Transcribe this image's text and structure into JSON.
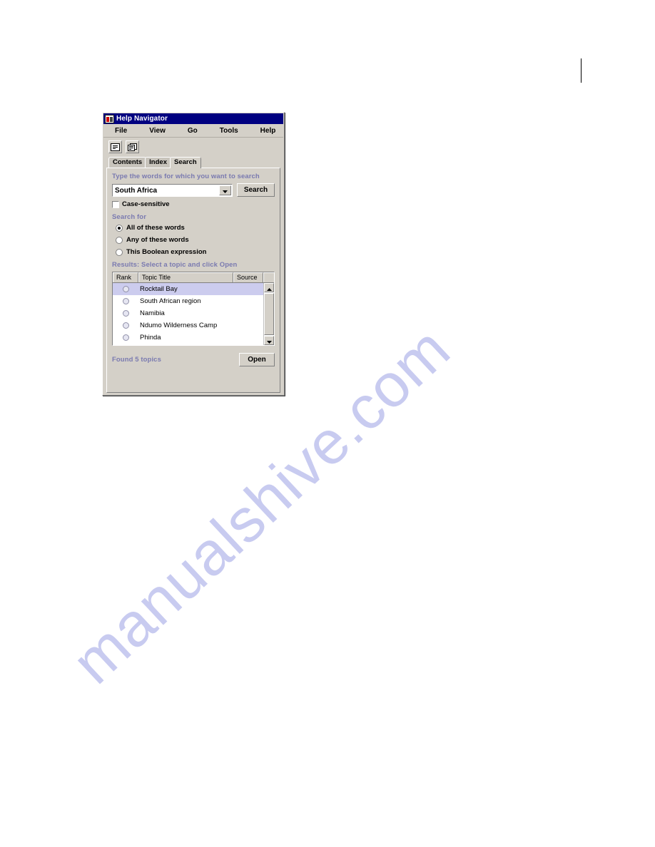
{
  "page": {
    "watermark_text": "manualshive.com"
  },
  "window": {
    "title": "Help Navigator",
    "icon": "help-book-icon"
  },
  "menubar": {
    "items": [
      {
        "label": "File"
      },
      {
        "label": "View"
      },
      {
        "label": "Go"
      },
      {
        "label": "Tools"
      },
      {
        "label": "Help"
      }
    ]
  },
  "toolbar": {
    "buttons": [
      {
        "icon": "single-pane-icon"
      },
      {
        "icon": "dual-pane-icon"
      }
    ]
  },
  "tabs": [
    {
      "label": "Contents",
      "active": false
    },
    {
      "label": "Index",
      "active": false
    },
    {
      "label": "Search",
      "active": true
    }
  ],
  "search_panel": {
    "prompt_label": "Type the words for which you want to search",
    "query_value": "South Africa",
    "query_placeholder": "",
    "dropdown_icon": "chevron-down-icon",
    "search_button": "Search",
    "case_sensitive_label": "Case-sensitive",
    "case_sensitive_checked": false,
    "search_for_label": "Search for",
    "options": [
      {
        "label": "All of these words",
        "selected": true
      },
      {
        "label": "Any of these words",
        "selected": false
      },
      {
        "label": "This Boolean expression",
        "selected": false
      }
    ]
  },
  "results": {
    "header_label": "Results: Select a topic and click Open",
    "columns": [
      "Rank",
      "Topic Title",
      "Source"
    ],
    "rows": [
      {
        "rank_icon": "rank-circle-icon",
        "title": "Rocktail Bay",
        "source": "",
        "selected": true
      },
      {
        "rank_icon": "rank-circle-icon",
        "title": "South African region",
        "source": "",
        "selected": false
      },
      {
        "rank_icon": "rank-circle-icon",
        "title": "Namibia",
        "source": "",
        "selected": false
      },
      {
        "rank_icon": "rank-circle-icon",
        "title": "Ndumo Wilderness Camp",
        "source": "",
        "selected": false
      },
      {
        "rank_icon": "rank-circle-icon",
        "title": "Phinda",
        "source": "",
        "selected": false
      }
    ],
    "scroll_up_icon": "triangle-up-icon",
    "scroll_down_icon": "triangle-down-icon"
  },
  "footer": {
    "status_text": "Found 5 topics",
    "open_button": "Open"
  },
  "colors": {
    "titlebar": "#000080",
    "face": "#d4d0c8",
    "label_purple": "#7a7ab0",
    "selection": "#ccccee",
    "watermark": "#c8cbf0"
  }
}
